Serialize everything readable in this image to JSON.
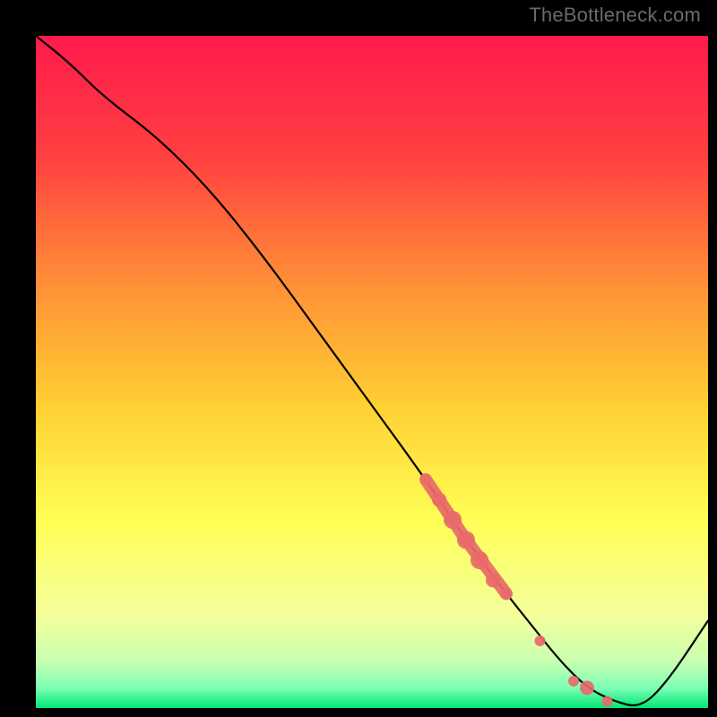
{
  "watermark": "TheBottleneck.com",
  "colors": {
    "bg_black": "#000000",
    "curve": "#000000",
    "marker": "#e86a6a",
    "grad_top": "#ff1744",
    "grad_mid_upper": "#ff8a3d",
    "grad_mid": "#ffd633",
    "grad_mid_lower": "#ffff66",
    "grad_low": "#e6ffb3",
    "grad_bottom": "#00e676"
  },
  "chart_data": {
    "type": "line",
    "title": "",
    "xlabel": "",
    "ylabel": "",
    "xlim": [
      0,
      100
    ],
    "ylim": [
      0,
      100
    ],
    "series": [
      {
        "name": "bottleneck-curve",
        "x": [
          0,
          5,
          10,
          18,
          26,
          34,
          42,
          50,
          58,
          64,
          70,
          74,
          78,
          82,
          86,
          90,
          94,
          100
        ],
        "y": [
          100,
          96,
          91,
          85,
          77,
          67,
          56,
          45,
          34,
          25,
          17,
          12,
          7,
          3,
          1,
          0,
          4,
          13
        ]
      }
    ],
    "markers": {
      "name": "highlight-segment",
      "points": [
        {
          "x": 58,
          "y": 34,
          "r": 3
        },
        {
          "x": 60,
          "y": 31,
          "r": 4
        },
        {
          "x": 62,
          "y": 28,
          "r": 5
        },
        {
          "x": 64,
          "y": 25,
          "r": 5
        },
        {
          "x": 66,
          "y": 22,
          "r": 5
        },
        {
          "x": 68,
          "y": 19,
          "r": 4
        },
        {
          "x": 70,
          "y": 17,
          "r": 3
        },
        {
          "x": 75,
          "y": 10,
          "r": 3
        },
        {
          "x": 80,
          "y": 4,
          "r": 3
        },
        {
          "x": 82,
          "y": 3,
          "r": 4
        },
        {
          "x": 85,
          "y": 1,
          "r": 3
        }
      ]
    },
    "gradient_stops": [
      {
        "offset": 0.0,
        "color": "#ff1a4d"
      },
      {
        "offset": 0.18,
        "color": "#ff4040"
      },
      {
        "offset": 0.38,
        "color": "#ff9436"
      },
      {
        "offset": 0.55,
        "color": "#ffcf33"
      },
      {
        "offset": 0.72,
        "color": "#ffff55"
      },
      {
        "offset": 0.86,
        "color": "#f4ff9a"
      },
      {
        "offset": 0.93,
        "color": "#c9ffb0"
      },
      {
        "offset": 0.97,
        "color": "#7dffb4"
      },
      {
        "offset": 1.0,
        "color": "#00e676"
      }
    ]
  }
}
